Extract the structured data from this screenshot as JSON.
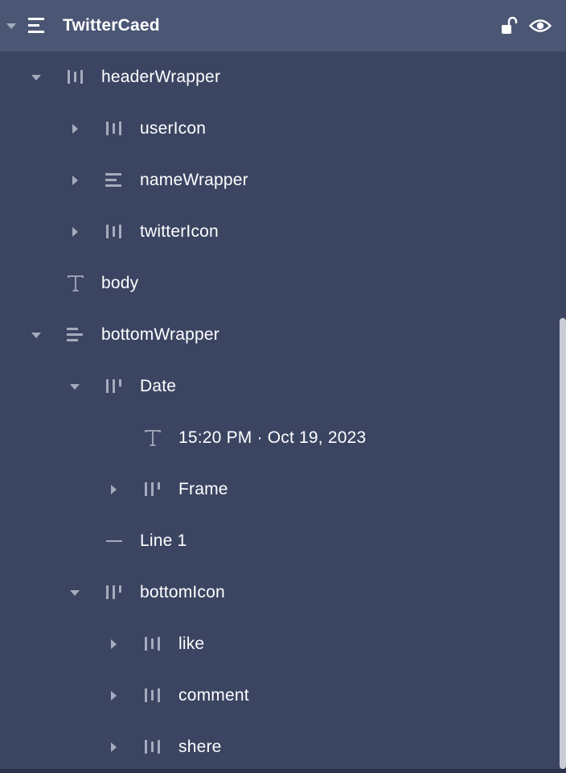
{
  "panel": {
    "title": "TwitterCaed",
    "actions": [
      {
        "icon": "unlock-icon"
      },
      {
        "icon": "eye-icon"
      }
    ]
  },
  "tree": [
    {
      "label": "headerWrapper",
      "icon": "auto-layout-horizontal-icon",
      "expanded": true
    },
    {
      "label": "userIcon",
      "icon": "auto-layout-horizontal-icon",
      "expanded": false
    },
    {
      "label": "nameWrapper",
      "icon": "auto-layout-vertical-icon",
      "expanded": false
    },
    {
      "label": "twitterIcon",
      "icon": "auto-layout-horizontal-icon",
      "expanded": false
    },
    {
      "label": "body",
      "icon": "text-icon"
    },
    {
      "label": "bottomWrapper",
      "icon": "auto-layout-vertical-icon",
      "expanded": true
    },
    {
      "label": "Date",
      "icon": "auto-layout-horizontal-icon",
      "expanded": true
    },
    {
      "label": "15:20 PM · Oct 19, 2023",
      "icon": "text-icon"
    },
    {
      "label": "Frame",
      "icon": "auto-layout-horizontal-icon",
      "expanded": false
    },
    {
      "label": "Line 1",
      "icon": "line-icon"
    },
    {
      "label": "bottomIcon",
      "icon": "auto-layout-horizontal-icon",
      "expanded": true
    },
    {
      "label": "like",
      "icon": "auto-layout-horizontal-icon",
      "expanded": false
    },
    {
      "label": "comment",
      "icon": "auto-layout-horizontal-icon",
      "expanded": false
    },
    {
      "label": "shere",
      "icon": "auto-layout-horizontal-icon",
      "expanded": false
    }
  ],
  "colors": {
    "background": "#3b4562",
    "header_background": "#4a5674",
    "icon": "#a4abbd",
    "text": "#ffffff"
  }
}
